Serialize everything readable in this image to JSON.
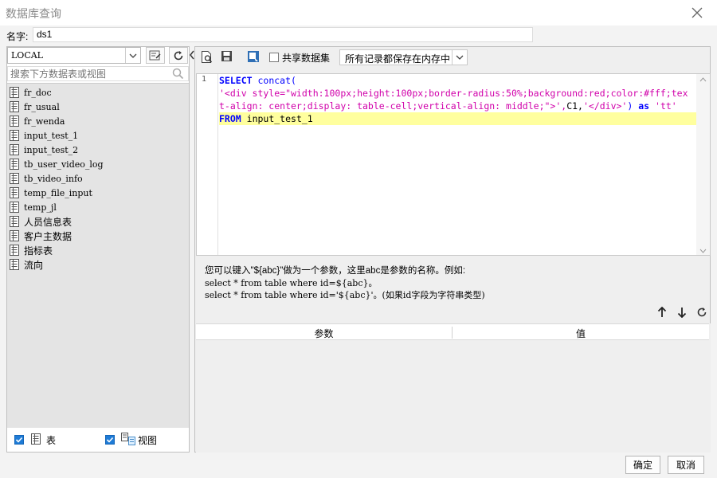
{
  "window": {
    "title": "数据库查询"
  },
  "name": {
    "label": "名字:",
    "value": "ds1"
  },
  "left": {
    "connection": "LOCAL",
    "search_placeholder": "搜索下方数据表或视图",
    "tables": [
      {
        "label": "fr_doc"
      },
      {
        "label": "fr_usual"
      },
      {
        "label": "fr_wenda"
      },
      {
        "label": "input_test_1"
      },
      {
        "label": "input_test_2"
      },
      {
        "label": "tb_user_video_log"
      },
      {
        "label": "tb_video_info"
      },
      {
        "label": "temp_file_input"
      },
      {
        "label": "temp_jl"
      },
      {
        "label": "人员信息表"
      },
      {
        "label": "客户主数据"
      },
      {
        "label": "指标表"
      },
      {
        "label": "流向"
      }
    ],
    "filter_table_label": "表",
    "filter_view_label": "视图"
  },
  "toolbar": {
    "share_label": "共享数据集",
    "memory_option": "所有记录都保存在内存中"
  },
  "editor": {
    "line_number": "1",
    "line1_kw": "SELECT",
    "line1_fn": "concat(",
    "line2": "'<div style=\"width:100px;height:100px;border-radius:50%;background:red;color:#fff;tex",
    "line3_str": "t-align: center;display: table-cell;vertical-align: middle;\">',",
    "line3_rest": "C1,",
    "line3_str2": "'</div>'",
    "line3_close": ")",
    "line3_as": "as",
    "line3_alias": "'tt'",
    "line4_kw": "FROM",
    "line4_rest": "input_test_1"
  },
  "hint": {
    "line1": "您可以键入\"${abc}\"做为一个参数，这里abc是参数的名称。例如:",
    "line2": "select * from table where id=${abc}。",
    "line3": "select * from table where id='${abc}'。(如果id字段为字符串类型)"
  },
  "params": {
    "col_param": "参数",
    "col_value": "值"
  },
  "footer": {
    "ok": "确定",
    "cancel": "取消"
  }
}
